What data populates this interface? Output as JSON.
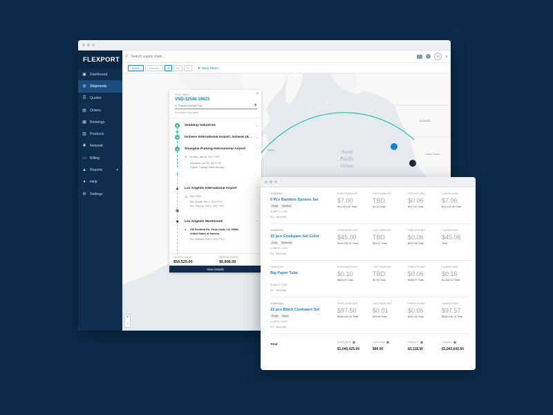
{
  "app": {
    "brand": "FLEXPORT"
  },
  "search": {
    "placeholder": "Search supply chain..."
  },
  "user": {
    "initials": "JS"
  },
  "sidebar": {
    "items": [
      {
        "label": "Dashboard",
        "icon": "dashboard-icon"
      },
      {
        "label": "Shipments",
        "icon": "shipments-icon",
        "active": true
      },
      {
        "label": "Quotes",
        "icon": "quotes-icon"
      },
      {
        "label": "Orders",
        "icon": "orders-icon"
      },
      {
        "label": "Bookings",
        "icon": "bookings-icon"
      },
      {
        "label": "Products",
        "icon": "products-icon"
      },
      {
        "label": "Network",
        "icon": "network-icon"
      },
      {
        "label": "Billing",
        "icon": "billing-icon"
      },
      {
        "label": "Reports",
        "icon": "reports-icon"
      },
      {
        "label": "Help",
        "icon": "help-icon"
      },
      {
        "label": "Settings",
        "icon": "settings-icon"
      }
    ]
  },
  "filters": {
    "active": "Active",
    "inactive": "Inactive",
    "btn_a": "Air",
    "btn_b": "Tr",
    "more": "More Filters"
  },
  "map": {
    "ocean_line1": "North",
    "ocean_line2": "Pacific",
    "ocean_line3": "Ocean",
    "label_canada": "Canada",
    "label_china": "China",
    "label_mongolia": "Mongolia",
    "label_japan": "Japan",
    "label_united_states": "United States",
    "label_mexico": "Mexico",
    "zoom_in": "+",
    "zoom_out": "−"
  },
  "shipment": {
    "ref": "FLEX-00821",
    "id": "VND-32546-19823",
    "status": "In Transit to Arrival Port",
    "doc": "Document Uploaded",
    "stops": [
      {
        "name": "Vandelay Industries"
      },
      {
        "name": "Incheon International Airport, Incheon (K..."
      },
      {
        "name": "Shanghai Pudong International Airport",
        "lines": [
          "Arrived: Jan 30, 2017 CST",
          "Departed: Jan 30, 2017 CST",
          "Carrier: Cathay Pacific Airways"
        ]
      },
      {
        "name": "Los Angeles International Airport",
        "lines": [
          "Port 2720",
          "Est. Arrival: Feb 1, 2017 PST",
          "Est. Pick-Up: Feb 2, 2017 PST"
        ]
      },
      {
        "name": "Los Angeles Warehouse",
        "lines": [
          "238 Richfield Rd, Yorba Linda, CA, 92886,",
          "United States of America",
          "Est. Delivery: Feb 3, 2017 PST"
        ]
      }
    ],
    "invoice_label": "INVOICE VALUE",
    "invoice_value": "$50,525.00",
    "freight_label": "FREIGHT SPEND",
    "freight_value": "$6,896.00",
    "view_details": "View Details"
  },
  "products_table": {
    "headers": {
      "purchase": "PURCHASE/UNIT",
      "customs": "CUSTOMS/UNIT",
      "freight": "FREIGHT/UNIT",
      "landed": "LANDED/UNIT"
    },
    "rows": [
      {
        "sku": "VRB889847",
        "name": "5 Pcs Bamboo Spoons Set",
        "tags": [
          "Finish",
          "Bamboo"
        ],
        "units": "# UNITS: 2,000",
        "po": "PO: 76811588",
        "purchase": "$7.00",
        "purchase_total": "$14,000.00 Total",
        "customs": "TBD",
        "customs_total": "$1.33 Total",
        "freight": "$0.06",
        "freight_total": "$117.02 Total",
        "landed": "$7.06",
        "landed_total": "$14,118.35 Total"
      },
      {
        "sku": "VRB889843",
        "name": "15 pcs Cookware Set Color",
        "tags": [
          "Color",
          "Multicolor"
        ],
        "units": "# UNITS: 7,000",
        "po": "PO: 76811588",
        "purchase": "$45.00",
        "purchase_total": "$315,000.00 Total",
        "customs": "TBD",
        "customs_total": "$29.97 Total",
        "freight": "$0.06",
        "freight_total": "$409.58 Total",
        "landed": "$45.06",
        "landed_total": "Total"
      },
      {
        "sku": "VNB134344",
        "name": "Big Paper Tube",
        "tags": [],
        "units": "# UNITS: 8,000",
        "po": "PO: 76811588",
        "purchase": "$0.10",
        "purchase_total": "$800.00 Total",
        "customs": "TBD",
        "customs_total": "$0.38 Total",
        "freight": "$0.06",
        "freight_total": "$468.07 Total",
        "landed": "$0.16",
        "landed_total": "$1,268.14 Total"
      },
      {
        "sku": "VRB889846",
        "name": "15 pcs Black Cookware Set",
        "tags": [
          "Finish",
          "Black"
        ],
        "units": "# UNITS: 6,000",
        "po": "PO: 76811588",
        "purchase": "$97.50",
        "purchase_total": "$585,000.00 Total",
        "customs": "$0.01",
        "customs_total": "$55.86 Total",
        "freight": "$0.06",
        "freight_total": "$351.05 Total",
        "landed": "$97.57",
        "landed_total": "$585,406.74 Total"
      }
    ],
    "totals": {
      "label": "Total",
      "purchase_h": "PURCHASE",
      "customs_h": "CUSTOMS",
      "freight_h": "FREIGHT",
      "landed_h": "LANDED",
      "purchase": "$1,040,425.00",
      "customs": "$99.00",
      "freight": "$3,118.50",
      "landed": "$1,043,642.50"
    }
  }
}
